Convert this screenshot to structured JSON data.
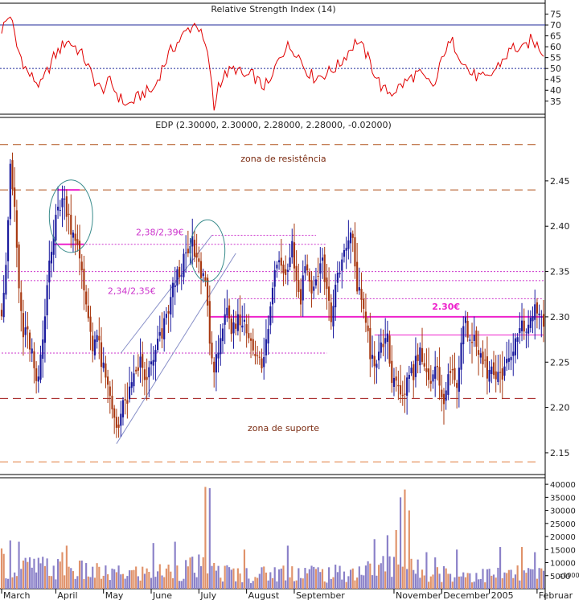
{
  "chart_data": [
    {
      "type": "line",
      "panel": "rsi",
      "title": "Relative Strength Index (14)",
      "x_axis": "trading-day index 0-250 (Mar 2004 - Feb 2005)",
      "y_ticks": [
        35,
        40,
        45,
        50,
        55,
        60,
        65,
        70,
        75
      ],
      "ylim": [
        29,
        80
      ],
      "reference_lines": [
        {
          "value": 70,
          "style": "solid",
          "color": "#1f2a9a"
        },
        {
          "value": 50,
          "style": "dotted",
          "color": "#1f2a9a"
        }
      ],
      "series": [
        {
          "color": "#e00000",
          "anchors": [
            [
              0,
              68
            ],
            [
              4,
              75
            ],
            [
              7,
              60
            ],
            [
              12,
              48
            ],
            [
              18,
              42
            ],
            [
              24,
              55
            ],
            [
              30,
              63
            ],
            [
              34,
              60
            ],
            [
              38,
              55
            ],
            [
              42,
              46
            ],
            [
              46,
              40
            ],
            [
              50,
              44
            ],
            [
              54,
              37
            ],
            [
              58,
              33
            ],
            [
              62,
              36
            ],
            [
              66,
              39
            ],
            [
              70,
              40
            ],
            [
              74,
              50
            ],
            [
              78,
              58
            ],
            [
              82,
              63
            ],
            [
              86,
              68
            ],
            [
              90,
              71
            ],
            [
              94,
              60
            ],
            [
              96,
              51
            ],
            [
              98,
              31
            ],
            [
              100,
              43
            ],
            [
              104,
              48
            ],
            [
              108,
              50
            ],
            [
              112,
              46
            ],
            [
              116,
              47
            ],
            [
              120,
              42
            ],
            [
              124,
              43
            ],
            [
              128,
              56
            ],
            [
              132,
              60
            ],
            [
              136,
              58
            ],
            [
              140,
              50
            ],
            [
              144,
              46
            ],
            [
              148,
              47
            ],
            [
              152,
              49
            ],
            [
              156,
              52
            ],
            [
              160,
              58
            ],
            [
              164,
              63
            ],
            [
              168,
              57
            ],
            [
              172,
              48
            ],
            [
              176,
              40
            ],
            [
              180,
              39
            ],
            [
              184,
              42
            ],
            [
              188,
              45
            ],
            [
              192,
              48
            ],
            [
              196,
              44
            ],
            [
              200,
              42
            ],
            [
              204,
              58
            ],
            [
              208,
              62
            ],
            [
              212,
              55
            ],
            [
              216,
              48
            ],
            [
              220,
              46
            ],
            [
              224,
              45
            ],
            [
              228,
              50
            ],
            [
              232,
              55
            ],
            [
              236,
              60
            ],
            [
              240,
              58
            ],
            [
              244,
              63
            ],
            [
              248,
              60
            ],
            [
              250,
              57
            ]
          ]
        }
      ]
    },
    {
      "type": "candlestick",
      "panel": "price",
      "title": "EDP (2.30000, 2.30000, 2.28000, 2.28000, -0.02000)",
      "y_ticks": [
        2.15,
        2.2,
        2.25,
        2.3,
        2.35,
        2.4,
        2.45
      ],
      "ylim": [
        2.126,
        2.52
      ],
      "colors": {
        "up": "#1a1a9e",
        "down": "#a83810"
      },
      "close_anchors": [
        [
          0,
          2.31
        ],
        [
          2,
          2.36
        ],
        [
          4,
          2.46
        ],
        [
          6,
          2.42
        ],
        [
          8,
          2.33
        ],
        [
          10,
          2.28
        ],
        [
          12,
          2.28
        ],
        [
          14,
          2.26
        ],
        [
          16,
          2.22
        ],
        [
          18,
          2.25
        ],
        [
          20,
          2.3
        ],
        [
          22,
          2.37
        ],
        [
          24,
          2.39
        ],
        [
          26,
          2.42
        ],
        [
          28,
          2.43
        ],
        [
          30,
          2.42
        ],
        [
          32,
          2.4
        ],
        [
          34,
          2.39
        ],
        [
          36,
          2.36
        ],
        [
          38,
          2.33
        ],
        [
          40,
          2.3
        ],
        [
          42,
          2.27
        ],
        [
          44,
          2.28
        ],
        [
          46,
          2.25
        ],
        [
          48,
          2.23
        ],
        [
          50,
          2.21
        ],
        [
          52,
          2.19
        ],
        [
          54,
          2.18
        ],
        [
          56,
          2.2
        ],
        [
          58,
          2.21
        ],
        [
          60,
          2.22
        ],
        [
          62,
          2.24
        ],
        [
          64,
          2.25
        ],
        [
          66,
          2.23
        ],
        [
          68,
          2.24
        ],
        [
          70,
          2.25
        ],
        [
          72,
          2.27
        ],
        [
          74,
          2.28
        ],
        [
          76,
          2.3
        ],
        [
          78,
          2.32
        ],
        [
          80,
          2.34
        ],
        [
          82,
          2.35
        ],
        [
          84,
          2.36
        ],
        [
          86,
          2.37
        ],
        [
          88,
          2.38
        ],
        [
          90,
          2.36
        ],
        [
          92,
          2.35
        ],
        [
          94,
          2.34
        ],
        [
          96,
          2.28
        ],
        [
          98,
          2.23
        ],
        [
          100,
          2.27
        ],
        [
          102,
          2.29
        ],
        [
          104,
          2.3
        ],
        [
          106,
          2.28
        ],
        [
          108,
          2.29
        ],
        [
          110,
          2.3
        ],
        [
          112,
          2.29
        ],
        [
          114,
          2.28
        ],
        [
          116,
          2.27
        ],
        [
          118,
          2.26
        ],
        [
          120,
          2.24
        ],
        [
          122,
          2.27
        ],
        [
          124,
          2.31
        ],
        [
          126,
          2.35
        ],
        [
          128,
          2.37
        ],
        [
          130,
          2.35
        ],
        [
          132,
          2.36
        ],
        [
          134,
          2.38
        ],
        [
          136,
          2.34
        ],
        [
          138,
          2.32
        ],
        [
          140,
          2.36
        ],
        [
          142,
          2.34
        ],
        [
          144,
          2.33
        ],
        [
          146,
          2.35
        ],
        [
          148,
          2.36
        ],
        [
          150,
          2.33
        ],
        [
          152,
          2.3
        ],
        [
          154,
          2.33
        ],
        [
          156,
          2.35
        ],
        [
          158,
          2.37
        ],
        [
          160,
          2.38
        ],
        [
          162,
          2.39
        ],
        [
          164,
          2.33
        ],
        [
          166,
          2.32
        ],
        [
          168,
          2.3
        ],
        [
          170,
          2.26
        ],
        [
          172,
          2.24
        ],
        [
          174,
          2.26
        ],
        [
          176,
          2.27
        ],
        [
          178,
          2.28
        ],
        [
          180,
          2.23
        ],
        [
          182,
          2.22
        ],
        [
          184,
          2.21
        ],
        [
          186,
          2.22
        ],
        [
          188,
          2.24
        ],
        [
          190,
          2.24
        ],
        [
          192,
          2.26
        ],
        [
          194,
          2.26
        ],
        [
          196,
          2.24
        ],
        [
          198,
          2.22
        ],
        [
          200,
          2.24
        ],
        [
          202,
          2.23
        ],
        [
          204,
          2.21
        ],
        [
          206,
          2.23
        ],
        [
          208,
          2.24
        ],
        [
          210,
          2.23
        ],
        [
          212,
          2.27
        ],
        [
          214,
          2.29
        ],
        [
          216,
          2.28
        ],
        [
          218,
          2.27
        ],
        [
          220,
          2.26
        ],
        [
          222,
          2.25
        ],
        [
          224,
          2.24
        ],
        [
          226,
          2.24
        ],
        [
          228,
          2.23
        ],
        [
          230,
          2.23
        ],
        [
          232,
          2.24
        ],
        [
          234,
          2.25
        ],
        [
          236,
          2.27
        ],
        [
          238,
          2.28
        ],
        [
          240,
          2.29
        ],
        [
          242,
          2.28
        ],
        [
          244,
          2.3
        ],
        [
          246,
          2.31
        ],
        [
          248,
          2.31
        ],
        [
          250,
          2.29
        ]
      ],
      "levels": [
        {
          "value": 2.49,
          "color": "#b0521c",
          "style": "long-dash"
        },
        {
          "value": 2.44,
          "color": "#b0521c",
          "style": "long-dash"
        },
        {
          "value": 2.21,
          "color": "#a01818",
          "style": "long-dash"
        },
        {
          "value": 2.14,
          "color": "#e07d3c",
          "style": "long-dash"
        }
      ],
      "segments": [
        {
          "x": [
            0,
            250
          ],
          "value": 2.35,
          "color": "#cc33cc",
          "style": "dotted"
        },
        {
          "x": [
            0,
            250
          ],
          "value": 2.34,
          "color": "#cc33cc",
          "style": "dotted"
        },
        {
          "x": [
            0,
            150
          ],
          "value": 2.26,
          "color": "#cc33cc",
          "style": "dotted"
        },
        {
          "x": [
            24,
            150
          ],
          "value": 2.38,
          "color": "#cc33cc",
          "style": "dotted"
        },
        {
          "x": [
            97,
            145
          ],
          "value": 2.39,
          "color": "#cc33cc",
          "style": "dotted"
        },
        {
          "x": [
            106,
            250
          ],
          "value": 2.32,
          "color": "#cc33cc",
          "style": "dotted"
        },
        {
          "x": [
            96,
            250
          ],
          "value": 2.3,
          "color": "#ee22cc",
          "style": "solid-thick"
        },
        {
          "x": [
            24,
            38
          ],
          "value": 2.38,
          "color": "#ee22cc",
          "style": "solid-thick"
        },
        {
          "x": [
            26,
            36
          ],
          "value": 2.44,
          "color": "#ee22cc",
          "style": "solid-thick"
        },
        {
          "x": [
            172,
            250
          ],
          "value": 2.28,
          "color": "#ee22cc",
          "style": "solid"
        }
      ],
      "channel": {
        "lower": [
          [
            53,
            2.16
          ],
          [
            108,
            2.37
          ]
        ],
        "upper": [
          [
            55,
            2.26
          ],
          [
            97,
            2.39
          ]
        ],
        "color": "#8890c8"
      },
      "ellipses": [
        {
          "cx": 32,
          "cy": 2.411,
          "rx": 10,
          "ry": 0.04
        },
        {
          "cx": 95,
          "cy": 2.373,
          "rx": 8,
          "ry": 0.034
        }
      ],
      "annotations": [
        {
          "text": "zona de resistência",
          "x": 130,
          "y": 2.471,
          "color": "#7a2a10"
        },
        {
          "text": "zona de suporte",
          "x": 130,
          "y": 2.174,
          "color": "#7a2a10"
        },
        {
          "text": "2,38/2,39€",
          "x": 73,
          "y": 2.39,
          "color": "#cc33cc"
        },
        {
          "text": "2,34/2,35€",
          "x": 60,
          "y": 2.325,
          "color": "#cc33cc"
        },
        {
          "text": "2.30€",
          "x": 205,
          "y": 2.308,
          "color": "#ee22cc",
          "bold": true
        }
      ]
    },
    {
      "type": "bar",
      "panel": "volume",
      "y_ticks": [
        5000,
        10000,
        15000,
        20000,
        25000,
        30000,
        35000,
        40000
      ],
      "ylim": [
        0,
        42500
      ],
      "multiplier_label": "x1000",
      "colors": {
        "up": "#8a80c8",
        "down": "#e0926a"
      },
      "baseline_anchors": [
        [
          0,
          10500
        ],
        [
          10,
          9000
        ],
        [
          20,
          8500
        ],
        [
          30,
          8000
        ],
        [
          40,
          7000
        ],
        [
          50,
          6000
        ],
        [
          60,
          6500
        ],
        [
          70,
          6500
        ],
        [
          80,
          7500
        ],
        [
          90,
          9000
        ],
        [
          100,
          7000
        ],
        [
          110,
          6000
        ],
        [
          120,
          6000
        ],
        [
          130,
          7000
        ],
        [
          140,
          7500
        ],
        [
          150,
          6000
        ],
        [
          160,
          6500
        ],
        [
          170,
          8000
        ],
        [
          180,
          10000
        ],
        [
          190,
          8000
        ],
        [
          200,
          6500
        ],
        [
          210,
          6500
        ],
        [
          220,
          5500
        ],
        [
          230,
          6000
        ],
        [
          240,
          6000
        ],
        [
          250,
          6000
        ]
      ],
      "spikes": [
        [
          4,
          18500
        ],
        [
          8,
          18000
        ],
        [
          28,
          14000
        ],
        [
          30,
          16500
        ],
        [
          70,
          17500
        ],
        [
          80,
          18000
        ],
        [
          94,
          39000
        ],
        [
          96,
          38500
        ],
        [
          112,
          15000
        ],
        [
          132,
          16500
        ],
        [
          172,
          19000
        ],
        [
          178,
          20500
        ],
        [
          182,
          22500
        ],
        [
          184,
          35000
        ],
        [
          186,
          38000
        ],
        [
          188,
          30000
        ],
        [
          196,
          14000
        ],
        [
          200,
          12000
        ],
        [
          210,
          15000
        ],
        [
          230,
          16000
        ],
        [
          240,
          16000
        ],
        [
          246,
          14000
        ]
      ],
      "x_labels": [
        {
          "label": "March",
          "index": 0
        },
        {
          "label": "April",
          "index": 25
        },
        {
          "label": "May",
          "index": 47
        },
        {
          "label": "June",
          "index": 69
        },
        {
          "label": "July",
          "index": 91
        },
        {
          "label": "August",
          "index": 113
        },
        {
          "label": "September",
          "index": 135
        },
        {
          "label": "November",
          "index": 181
        },
        {
          "label": "December",
          "index": 203
        },
        {
          "label": "2005",
          "index": 225
        },
        {
          "label": "Februar",
          "index": 247
        }
      ]
    }
  ]
}
